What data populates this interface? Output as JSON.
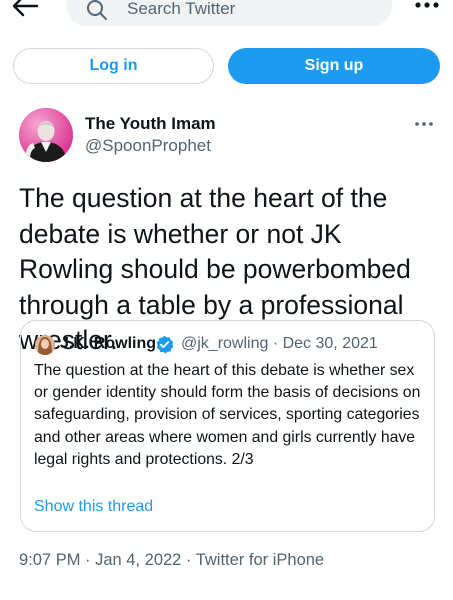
{
  "topbar": {
    "search_placeholder": "Search Twitter",
    "back_icon": "back-arrow-icon",
    "search_icon": "search-icon",
    "more_icon": "more-horizontal-icon"
  },
  "auth": {
    "login_label": "Log in",
    "signup_label": "Sign up"
  },
  "tweet": {
    "author": {
      "display_name": "The Youth Imam",
      "handle": "@SpoonProphet"
    },
    "text": "The question at the heart of the debate is whether or not JK Rowling should be powerbombed through a table by a professional wrestler.",
    "timestamp": "9:07 PM · Jan 4, 2022 · Twitter for iPhone",
    "quoted": {
      "display_name": "J.K. Rowling",
      "verified": true,
      "meta": "@jk_rowling · Dec 30, 2021",
      "text": "The question at the heart of this debate is whether sex or gender identity should form the basis of decisions on safeguarding, provision of services, sporting categories and other areas where women and girls currently have legal rights and protections. 2/3",
      "show_thread_label": "Show this thread"
    }
  },
  "colors": {
    "accent": "#1d9bf0",
    "secondary_text": "#536471",
    "border": "#cfd9de",
    "search_bg": "#eff3f4"
  }
}
